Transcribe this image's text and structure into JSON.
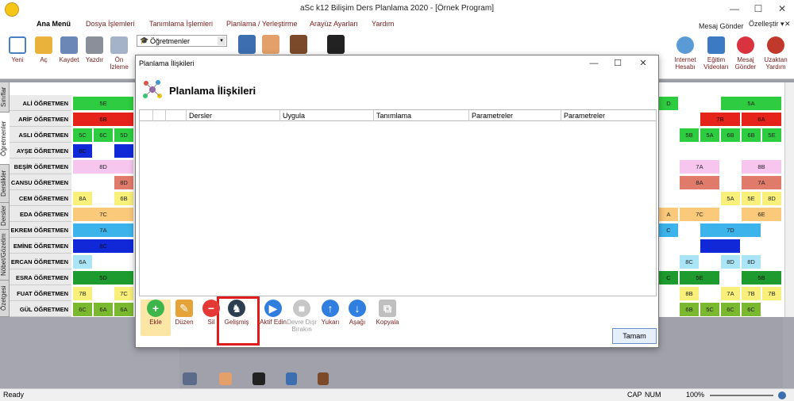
{
  "window": {
    "title": "aSc k12 Bilişim Ders Planlama 2020  - [Örnek Program]",
    "minimize": "—",
    "maximize": "☐",
    "close": "✕"
  },
  "menu": {
    "items": [
      "Ana Menü",
      "Dosya İşlemleri",
      "Tanımlama İşlemleri",
      "Planlama / Yerleştirme",
      "Arayüz Ayarları",
      "Yardım"
    ],
    "right_items": [
      "Mesaj Gönder",
      "Özelleştir ▾",
      "✕"
    ]
  },
  "ribbon": {
    "left_buttons": [
      {
        "label": "Yeni",
        "icon": "new-file-icon",
        "color": "#4a7fc1"
      },
      {
        "label": "Aç",
        "icon": "folder-open-icon",
        "color": "#e8b23b"
      },
      {
        "label": "Kaydet",
        "icon": "save-icon",
        "color": "#6b87b5"
      },
      {
        "label": "Yazdır",
        "icon": "printer-icon",
        "color": "#8a8f99"
      },
      {
        "label": "Ön İzleme",
        "icon": "preview-icon",
        "color": "#a5b3c8"
      }
    ],
    "view_combo": "Öğretmenler",
    "right_buttons": [
      {
        "label": "Internet Hesabı",
        "icon": "cloud-icon",
        "color": "#5b9bd5"
      },
      {
        "label": "Eğitim Videoları",
        "icon": "video-icon",
        "color": "#3c7bc4"
      },
      {
        "label": "Mesaj Gönder",
        "icon": "message-icon",
        "color": "#d9333f"
      },
      {
        "label": "Uzaktan Yardım",
        "icon": "remote-help-icon",
        "color": "#c0392b"
      }
    ]
  },
  "sidetabs": [
    "Sınıflar",
    "Öğretmenler",
    "Derslikler",
    "Dersler",
    "Nöbet/Gözetim",
    "Özetgesi"
  ],
  "teachers": [
    {
      "name": "ALİ ÖĞRETMEN",
      "cells": [
        {
          "t": "5E",
          "c": "#2ecc40",
          "col": 0,
          "span": 3
        },
        {
          "t": "D",
          "c": "#2ecc40",
          "col": "r0",
          "span": 1
        },
        {
          "t": "5A",
          "c": "#2ecc40",
          "col": "r3",
          "span": 3
        }
      ]
    },
    {
      "name": "ARİF ÖĞRETMEN",
      "cells": [
        {
          "t": "6B",
          "c": "#e5231b",
          "col": 0,
          "span": 3
        },
        {
          "t": "7B",
          "c": "#e5231b",
          "col": "r2",
          "span": 2
        },
        {
          "t": "6A",
          "c": "#e5231b",
          "col": "r4",
          "span": 2
        }
      ]
    },
    {
      "name": "ASLI ÖĞRETMEN",
      "cells": [
        {
          "t": "5C",
          "c": "#2ecc40",
          "col": 0,
          "span": 1
        },
        {
          "t": "6C",
          "c": "#2ecc40",
          "col": 1,
          "span": 1
        },
        {
          "t": "5D",
          "c": "#2ecc40",
          "col": 2,
          "span": 1
        },
        {
          "t": "5B",
          "c": "#2ecc40",
          "col": "r1",
          "span": 1
        },
        {
          "t": "5A",
          "c": "#2ecc40",
          "col": "r2",
          "span": 1
        },
        {
          "t": "6B",
          "c": "#2ecc40",
          "col": "r3",
          "span": 1
        },
        {
          "t": "6B",
          "c": "#2ecc40",
          "col": "r4",
          "span": 1
        },
        {
          "t": "5E",
          "c": "#2ecc40",
          "col": "r5",
          "span": 1
        }
      ]
    },
    {
      "name": "AYŞE ÖĞRETMEN",
      "cells": [
        {
          "t": "8C",
          "c": "#1028d8",
          "col": 0,
          "span": 1
        },
        {
          "t": "",
          "c": "#1028d8",
          "col": 2,
          "span": 1
        }
      ]
    },
    {
      "name": "BEŞİR ÖĞRETMEN",
      "cells": [
        {
          "t": "8D",
          "c": "#f7c6ef",
          "col": 0,
          "span": 3
        },
        {
          "t": "7A",
          "c": "#f7c6ef",
          "col": "r1",
          "span": 2
        },
        {
          "t": "8B",
          "c": "#f7c6ef",
          "col": "r4",
          "span": 2
        }
      ]
    },
    {
      "name": "CANSU ÖĞRETMEN",
      "cells": [
        {
          "t": "8D",
          "c": "#e07a6b",
          "col": 2,
          "span": 1
        },
        {
          "t": "8A",
          "c": "#e07a6b",
          "col": "r1",
          "span": 2
        },
        {
          "t": "7A",
          "c": "#e07a6b",
          "col": "r4",
          "span": 2
        }
      ]
    },
    {
      "name": "CEM ÖĞRETMEN",
      "cells": [
        {
          "t": "8A",
          "c": "#f9f07b",
          "col": 0,
          "span": 1
        },
        {
          "t": "6B",
          "c": "#f9f07b",
          "col": 2,
          "span": 1
        },
        {
          "t": "5A",
          "c": "#f9f07b",
          "col": "r3",
          "span": 1
        },
        {
          "t": "5E",
          "c": "#f9f07b",
          "col": "r4",
          "span": 1
        },
        {
          "t": "8D",
          "c": "#f9f07b",
          "col": "r5",
          "span": 1
        }
      ]
    },
    {
      "name": "EDA ÖĞRETMEN",
      "cells": [
        {
          "t": "7C",
          "c": "#fbc97a",
          "col": 0,
          "span": 3
        },
        {
          "t": "A",
          "c": "#fbc97a",
          "col": "r0",
          "span": 1
        },
        {
          "t": "7C",
          "c": "#fbc97a",
          "col": "r1",
          "span": 2
        },
        {
          "t": "6E",
          "c": "#fbc97a",
          "col": "r4",
          "span": 2
        }
      ]
    },
    {
      "name": "EKREM ÖĞRETMEN",
      "cells": [
        {
          "t": "7A",
          "c": "#3cb3ea",
          "col": 0,
          "span": 3
        },
        {
          "t": "C",
          "c": "#3cb3ea",
          "col": "r0",
          "span": 1
        },
        {
          "t": "7D",
          "c": "#3cb3ea",
          "col": "r2",
          "span": 3
        }
      ]
    },
    {
      "name": "EMİNE ÖĞRETMEN",
      "cells": [
        {
          "t": "8C",
          "c": "#1028d8",
          "col": 0,
          "span": 3
        },
        {
          "t": "",
          "c": "#1028d8",
          "col": "r2",
          "span": 2
        }
      ]
    },
    {
      "name": "ERCAN ÖĞRETMEN",
      "cells": [
        {
          "t": "6A",
          "c": "#a9e4f7",
          "col": 0,
          "span": 1
        },
        {
          "t": "8C",
          "c": "#a9e4f7",
          "col": "r1",
          "span": 1
        },
        {
          "t": "8D",
          "c": "#a9e4f7",
          "col": "r3",
          "span": 1
        },
        {
          "t": "8D",
          "c": "#a9e4f7",
          "col": "r4",
          "span": 1
        }
      ]
    },
    {
      "name": "ESRA ÖĞRETMEN",
      "cells": [
        {
          "t": "5D",
          "c": "#1e9b2f",
          "col": 0,
          "span": 3
        },
        {
          "t": "C",
          "c": "#1e9b2f",
          "col": "r0",
          "span": 1
        },
        {
          "t": "5E",
          "c": "#1e9b2f",
          "col": "r1",
          "span": 2
        },
        {
          "t": "5B",
          "c": "#1e9b2f",
          "col": "r4",
          "span": 2
        }
      ]
    },
    {
      "name": "FUAT ÖĞRETMEN",
      "cells": [
        {
          "t": "7B",
          "c": "#f9f07b",
          "col": 0,
          "span": 1
        },
        {
          "t": "7C",
          "c": "#f9f07b",
          "col": 2,
          "span": 1
        },
        {
          "t": "8B",
          "c": "#f9f07b",
          "col": "r1",
          "span": 1
        },
        {
          "t": "7A",
          "c": "#f9f07b",
          "col": "r3",
          "span": 1
        },
        {
          "t": "7B",
          "c": "#f9f07b",
          "col": "r4",
          "span": 1
        },
        {
          "t": "7B",
          "c": "#f9f07b",
          "col": "r5",
          "span": 1
        }
      ]
    },
    {
      "name": "GÜL ÖĞRETMEN",
      "cells": [
        {
          "t": "6C",
          "c": "#7ab82f",
          "col": 0,
          "span": 1
        },
        {
          "t": "6A",
          "c": "#7ab82f",
          "col": 1,
          "span": 1
        },
        {
          "t": "6A",
          "c": "#7ab82f",
          "col": 2,
          "span": 1
        },
        {
          "t": "6B",
          "c": "#7ab82f",
          "col": "r1",
          "span": 1
        },
        {
          "t": "5C",
          "c": "#7ab82f",
          "col": "r2",
          "span": 1
        },
        {
          "t": "6C",
          "c": "#7ab82f",
          "col": "r3",
          "span": 1
        },
        {
          "t": "6C",
          "c": "#7ab82f",
          "col": "r4",
          "span": 1
        }
      ]
    }
  ],
  "dialog": {
    "title": "Planlama İlişkileri",
    "heading": "Planlama İlişkileri",
    "columns": [
      "Dersler",
      "Uygula",
      "Tanımlama",
      "Parametreler",
      "Parametreler"
    ],
    "toolbar": [
      {
        "label": "Ekle",
        "icon": "add-icon",
        "color": "#3cb54a",
        "glyph": "+",
        "disabled": false
      },
      {
        "label": "Düzen",
        "icon": "pencil-icon",
        "color": "#e6a33a",
        "glyph": "✎",
        "disabled": false
      },
      {
        "label": "Sil",
        "icon": "delete-icon",
        "color": "#e53935",
        "glyph": "−",
        "disabled": false
      },
      {
        "label": "Gelişmiş",
        "icon": "chess-knight-icon",
        "color": "#2c3e50",
        "glyph": "♞",
        "disabled": false
      },
      {
        "label": "Aktif Edin",
        "icon": "play-icon",
        "color": "#2f7ee0",
        "glyph": "▶",
        "disabled": false
      },
      {
        "label": "Devre Dışı Bırakın",
        "icon": "stop-icon",
        "color": "#c7c7c7",
        "glyph": "■",
        "disabled": true
      },
      {
        "label": "Yukarı",
        "icon": "up-arrow-icon",
        "color": "#2f7ee0",
        "glyph": "↑",
        "disabled": false
      },
      {
        "label": "Aşağı",
        "icon": "down-arrow-icon",
        "color": "#2f7ee0",
        "glyph": "↓",
        "disabled": false
      },
      {
        "label": "Kopyala",
        "icon": "copy-icon",
        "color": "#bfbfbf",
        "glyph": "⧉",
        "disabled": false
      }
    ],
    "ok_label": "Tamam"
  },
  "status": {
    "left": "Ready",
    "caps": "CAP",
    "num": "NUM",
    "zoom": "100%"
  }
}
